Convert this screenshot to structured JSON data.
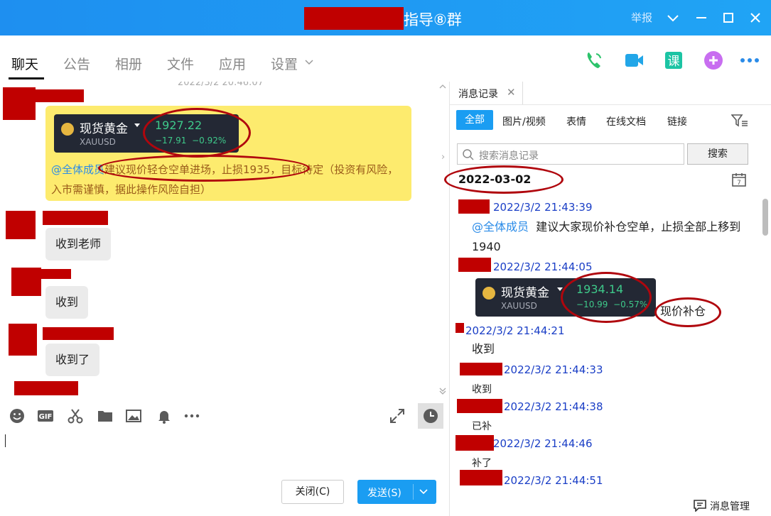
{
  "window": {
    "title": "指导⑧群",
    "report": "举报"
  },
  "nav": {
    "tabs": [
      "聊天",
      "公告",
      "相册",
      "文件",
      "应用",
      "设置"
    ],
    "icons": [
      "phone-icon",
      "video-icon",
      "lesson-icon",
      "add-icon",
      "more-icon"
    ],
    "lesson_glyph": "课"
  },
  "chat": {
    "timestamp": "2022/3/2 20:46:07",
    "gold_card": {
      "name": "现货黄金",
      "symbol": "XAUUSD",
      "price": "1927.22",
      "change": "−17.91",
      "change_pct": "−0.92%"
    },
    "announcement": {
      "mention": "@全体成员",
      "text": "建议现价轻仓空单进场，止损1935，目标待定（投资有风险，入市需谨慎，据此操作风险自担）"
    },
    "messages": [
      "收到老师",
      "收到",
      "收到了"
    ]
  },
  "input": {
    "close_label": "关闭(C)",
    "send_label": "发送(S)"
  },
  "panel": {
    "tab_label": "消息记录",
    "filters": [
      "全部",
      "图片/视频",
      "表情",
      "在线文档",
      "链接"
    ],
    "search_placeholder": "搜索消息记录",
    "search_button": "搜索",
    "date": "2022-03-02",
    "records": [
      {
        "time": "2022/3/2 21:43:39",
        "mention": "@全体成员",
        "text": "建议大家现价补仓空单，止损全部上移到1940"
      },
      {
        "time": "2022/3/2 21:44:05",
        "card": {
          "name": "现货黄金",
          "symbol": "XAUUSD",
          "price": "1934.14",
          "change": "−10.99",
          "change_pct": "−0.57%"
        },
        "text": "现价补仓"
      },
      {
        "time": "2022/3/2 21:44:21",
        "text": "收到"
      },
      {
        "time": "2022/3/2 21:44:33",
        "text": "收到"
      },
      {
        "time": "2022/3/2 21:44:38",
        "text": "已补"
      },
      {
        "time": "2022/3/2 21:44:46",
        "text": "补了"
      },
      {
        "time": "2022/3/2 21:44:51",
        "text": ""
      }
    ],
    "manage_label": "消息管理"
  },
  "colors": {
    "accent": "#1a9df2",
    "redaction": "#c00000",
    "annotation": "#b0060d",
    "announce_bg": "#fdeb6e",
    "gain": "#3ec98a"
  }
}
